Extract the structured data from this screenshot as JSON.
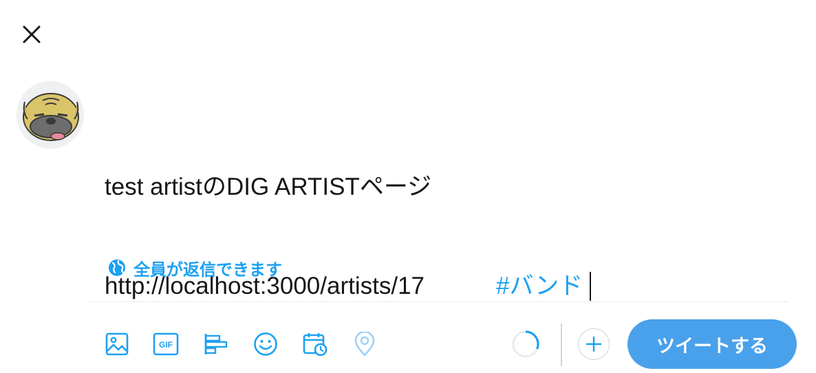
{
  "compose": {
    "line1": "test artistのDIG ARTISTページ",
    "url": "http://localhost:3000/artists/17",
    "hashtag": "#バンド"
  },
  "reply_setting": {
    "label": "全員が返信できます"
  },
  "toolbar": {
    "icons": [
      "image-icon",
      "gif-icon",
      "poll-icon",
      "emoji-icon",
      "schedule-icon",
      "location-icon"
    ],
    "gif_label": "GIF"
  },
  "tweet_button": {
    "label": "ツイートする"
  },
  "colors": {
    "accent": "#1da1f2",
    "button": "#4aa1eb",
    "text": "#14171a"
  }
}
